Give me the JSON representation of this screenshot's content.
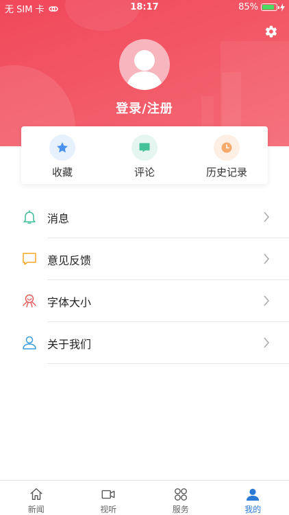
{
  "status_bar": {
    "carrier": "无 SIM 卡",
    "time": "18:17",
    "battery": "85%",
    "battery_level": 0.85
  },
  "header": {
    "login_text": "登录/注册",
    "settings_icon": "gear-icon",
    "avatar_icon": "user-avatar-icon"
  },
  "quick_actions": [
    {
      "label": "收藏",
      "icon": "star-icon",
      "color": "#4a90f0",
      "bg": "#e7f0fd"
    },
    {
      "label": "评论",
      "icon": "comment-icon",
      "color": "#45c19a",
      "bg": "#e4f6ef"
    },
    {
      "label": "历史记录",
      "icon": "clock-icon",
      "color": "#f5a96b",
      "bg": "#fdefe4"
    }
  ],
  "menu": [
    {
      "label": "消息",
      "icon": "bell-icon",
      "color": "#3cbf9a"
    },
    {
      "label": "意见反馈",
      "icon": "feedback-icon",
      "color": "#f5a623"
    },
    {
      "label": "字体大小",
      "icon": "font-size-icon",
      "color": "#e05a5a"
    },
    {
      "label": "关于我们",
      "icon": "about-user-icon",
      "color": "#3a9ee0"
    }
  ],
  "tabs": [
    {
      "label": "新闻",
      "icon": "home-icon",
      "active": false
    },
    {
      "label": "视听",
      "icon": "video-icon",
      "active": false
    },
    {
      "label": "服务",
      "icon": "grid-icon",
      "active": false
    },
    {
      "label": "我的",
      "icon": "person-icon",
      "active": true
    }
  ],
  "colors": {
    "brand": "#f0485a",
    "active_tab": "#2b7bd6"
  }
}
